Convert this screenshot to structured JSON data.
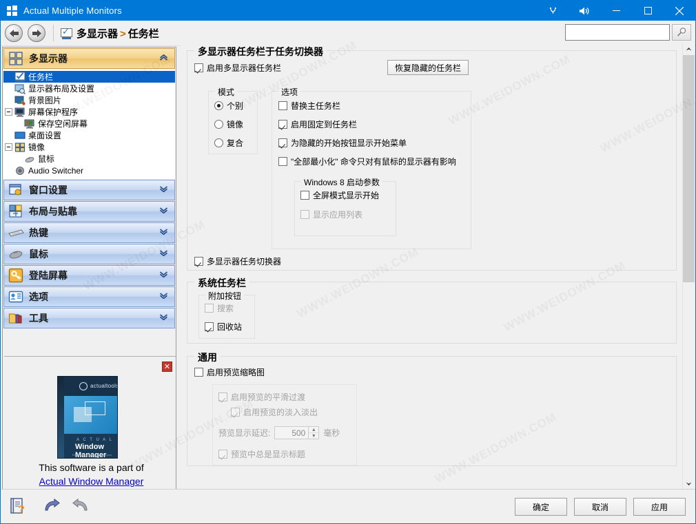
{
  "window": {
    "title": "Actual Multiple Monitors",
    "icon": "windows-squares-icon",
    "controls": {
      "pin": "⚷",
      "sound": "sound-icon",
      "minimize": "—",
      "maximize": "☐",
      "close": "✕"
    }
  },
  "navbar": {
    "back": "back-arrow-icon",
    "forward": "forward-arrow-icon",
    "breadcrumb_icon": "taskbar-monitor-icon",
    "breadcrumb_root": "多显示器",
    "breadcrumb_sep": ">",
    "breadcrumb_leaf": "任务栏",
    "search_value": "",
    "search_placeholder": "",
    "search_button_icon": "magnifier-icon"
  },
  "sidebar": {
    "categories": [
      {
        "label": "多显示器",
        "icon": "four-squares-icon",
        "active": true,
        "chevron": "⌃",
        "items": [
          {
            "label": "任务栏",
            "icon": "taskbar-icon",
            "selected": true,
            "indent": 1,
            "expander": "none"
          },
          {
            "label": "显示器布局及设置",
            "icon": "monitor-settings-icon",
            "selected": false,
            "indent": 1,
            "expander": "none"
          },
          {
            "label": "背景图片",
            "icon": "wallpaper-icon",
            "selected": false,
            "indent": 1,
            "expander": "none"
          },
          {
            "label": "屏幕保护程序",
            "icon": "screensaver-icon",
            "selected": false,
            "indent": 0,
            "expander": "minus"
          },
          {
            "label": "保存空闲屏幕",
            "icon": "idle-screen-icon",
            "selected": false,
            "indent": 2,
            "expander": "none"
          },
          {
            "label": "桌面设置",
            "icon": "desktop-icon",
            "selected": false,
            "indent": 1,
            "expander": "none"
          },
          {
            "label": "镜像",
            "icon": "mirror-icon",
            "selected": false,
            "indent": 0,
            "expander": "minus"
          },
          {
            "label": "鼠标",
            "icon": "mouse-icon",
            "selected": false,
            "indent": 2,
            "expander": "none"
          },
          {
            "label": "Audio Switcher",
            "icon": "speaker-icon",
            "selected": false,
            "indent": 1,
            "expander": "none"
          }
        ]
      },
      {
        "label": "窗口设置",
        "icon": "window-settings-icon",
        "active": false,
        "chevron": "⌄",
        "items": []
      },
      {
        "label": "布局与贴靠",
        "icon": "layout-snap-icon",
        "active": false,
        "chevron": "⌄",
        "items": []
      },
      {
        "label": "热键",
        "icon": "keyboard-icon",
        "active": false,
        "chevron": "⌄",
        "items": []
      },
      {
        "label": "鼠标",
        "icon": "mouse-icon",
        "active": false,
        "chevron": "⌄",
        "items": []
      },
      {
        "label": "登陆屏幕",
        "icon": "key-icon",
        "active": false,
        "chevron": "⌄",
        "items": []
      },
      {
        "label": "选项",
        "icon": "options-icon",
        "active": false,
        "chevron": "⌄",
        "items": []
      },
      {
        "label": "工具",
        "icon": "tools-icon",
        "active": false,
        "chevron": "⌄",
        "items": []
      }
    ]
  },
  "promo": {
    "close_label": "✕",
    "box_logo_text": "actualtools",
    "box_actual": "A C T U A L",
    "box_product": "Window Manager",
    "box_blurb": "Enhance the productivity of your work and make it smooth and convenient",
    "text": "This software is a part of",
    "link": "Actual Window Manager"
  },
  "main": {
    "group_taskbar": {
      "title": "多显示器任务栏于任务切换器",
      "enable_checkbox": {
        "label": "启用多显示器任务栏",
        "checked": true
      },
      "restore_button": "恢复隐藏的任务栏",
      "mode_group": {
        "title": "模式",
        "options": [
          {
            "label": "个别",
            "selected": true
          },
          {
            "label": "镜像",
            "selected": false
          },
          {
            "label": "复合",
            "selected": false
          }
        ]
      },
      "options_group": {
        "title": "选项",
        "items": [
          {
            "label": "替换主任务栏",
            "checked": false,
            "disabled": false
          },
          {
            "label": "启用固定到任务栏",
            "checked": true,
            "disabled": false
          },
          {
            "label": "为隐藏的开始按钮显示开始菜单",
            "checked": true,
            "disabled": false
          },
          {
            "label": "\"全部最小化\" 命令只对有鼠标的显示器有影响",
            "checked": false,
            "disabled": false
          }
        ],
        "win8_group": {
          "title": "Windows 8 启动参数",
          "items": [
            {
              "label": "全屏模式显示开始",
              "checked": false,
              "disabled": false
            },
            {
              "label": "显示应用列表",
              "checked": false,
              "disabled": true
            }
          ]
        }
      },
      "switcher_checkbox": {
        "label": "多显示器任务切换器",
        "checked": true
      }
    },
    "group_system_taskbar": {
      "title": "系统任务栏",
      "extra_buttons_group": {
        "title": "附加按钮",
        "items": [
          {
            "label": "搜索",
            "checked": false,
            "disabled": true
          },
          {
            "label": "回收站",
            "checked": true,
            "disabled": false
          }
        ]
      }
    },
    "group_general": {
      "title": "通用",
      "enable_thumbnails": {
        "label": "启用预览缩略图",
        "checked": false
      },
      "sub_items": [
        {
          "label": "启用预览的平滑过渡",
          "checked": true,
          "disabled": true,
          "indent": 0
        },
        {
          "label": "启用预览的淡入淡出",
          "checked": true,
          "disabled": true,
          "indent": 1
        }
      ],
      "delay": {
        "label": "预览显示延迟:",
        "value": "500",
        "unit": "毫秒",
        "disabled": true
      },
      "always_title": {
        "label": "预览中总是显示标题",
        "checked": true,
        "disabled": true
      }
    }
  },
  "scrollbar": {
    "up": "▲",
    "down": "▼"
  },
  "footer": {
    "help_icon": "help-book-icon",
    "undo_icon": "undo-arrow-icon",
    "redo_icon": "redo-arrow-icon",
    "buttons": [
      {
        "label": "确定"
      },
      {
        "label": "取消"
      },
      {
        "label": "应用"
      }
    ]
  },
  "watermarks": [
    "WWW.WEIDOWN.COM",
    "WWW.WEIDOWN.COM",
    "WWW.WEIDOWN.COM",
    "WWW.WEIDOWN.COM",
    "WWW.WEIDOWN.COM",
    "WWW.WEIDOWN.COM",
    "WWW.WEIDOWN.COM",
    "WWW.WEIDOWN.COM",
    "WWW.WEIDOWN.COM"
  ],
  "colors": {
    "titlebar": "#0078d7",
    "selection": "#0a64c8",
    "category_active": "#f3d18a",
    "category_inactive": "#c7d8f2",
    "link": "#0000c8"
  }
}
